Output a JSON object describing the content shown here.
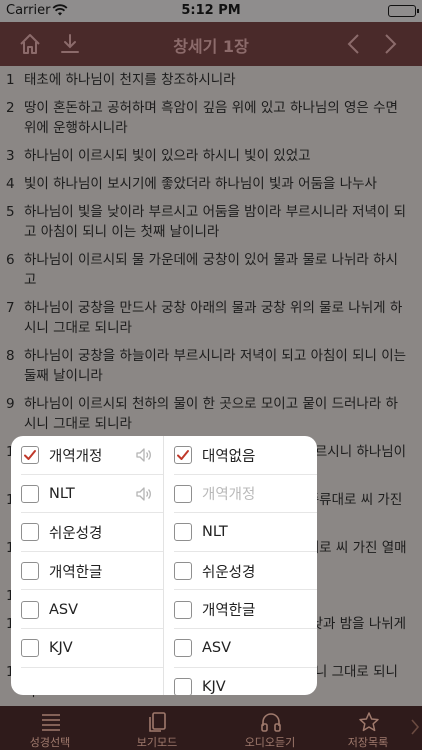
{
  "status_bar": {
    "carrier": "Carrier",
    "time": "5:12 PM"
  },
  "nav": {
    "title": "창세기 1장",
    "icons": [
      "home-icon",
      "download-icon",
      "chevron-left-icon",
      "chevron-right-icon"
    ]
  },
  "verses": [
    {
      "num": "1",
      "text": "태초에 하나님이 천지를 창조하시니라"
    },
    {
      "num": "2",
      "text": "땅이 혼돈하고 공허하며 흑암이 깊음 위에 있고 하나님의 영은 수면 위에 운행하시니라"
    },
    {
      "num": "3",
      "text": "하나님이 이르시되 빛이 있으라 하시니 빛이 있었고"
    },
    {
      "num": "4",
      "text": "빛이 하나님이 보시기에 좋았더라 하나님이 빛과 어둠을 나누사"
    },
    {
      "num": "5",
      "text": "하나님이 빛을 낮이라 부르시고 어둠을 밤이라 부르시니라 저녁이 되고 아침이 되니 이는 첫째 날이니라"
    },
    {
      "num": "6",
      "text": "하나님이 이르시되 물 가운데에 궁창이 있어 물과 물로 나뉘라 하시고"
    },
    {
      "num": "7",
      "text": "하나님이 궁창을 만드사 궁창 아래의 물과 궁창 위의 물로 나뉘게 하시니 그대로 되니라"
    },
    {
      "num": "8",
      "text": "하나님이 궁창을 하늘이라 부르시니라 저녁이 되고 아침이 되니 이는 둘째 날이니라"
    },
    {
      "num": "9",
      "text": "하나님이 이르시되 천하의 물이 한 곳으로 모이고 뭍이 드러나라 하시니 그대로 되니라"
    },
    {
      "num": "10",
      "text": "하나님이 뭍을 땅이라 부르시고 모인 물을 바다라 부르시니 하나님이 보시기에 좋았더라"
    },
    {
      "num": "11",
      "text": "하나님이 이르시되 땅은 풀과 씨 맺는 채소와 각기 종류대로 씨 가진 열매 맺는 나무를 내라 하시니 그대로 되어"
    },
    {
      "num": "12",
      "text": "땅이 풀과 각기 종류대로 씨 맺는 채소와 각기 종류대로 씨 가진 열매 맺는 나무를 내니 하나님이 보시기에 좋았더라"
    },
    {
      "num": "13",
      "text": "저녁이 되고 아침이 되니 이는 셋째 날이니라"
    },
    {
      "num": "14",
      "text": "하나님이 이르시되 하늘의 궁창에 광명체들이 있어 낮과 밤을 나뉘게 하고 그것들로 징조와 계절과 날과 해를 이루게 하라"
    },
    {
      "num": "15",
      "text": "또 광명체들이 하늘의 궁창에 있어 땅을 비추라 하시니 그대로 되니라"
    },
    {
      "num": "16",
      "text": "하나님이 두 큰 광명체를 만드사 큰 광명체로 낮을 주관하게 하시고 작은 광명체로 밤을 주관하게 하시며 또 별들을 만드시고"
    },
    {
      "num": "17",
      "text": "하나님이 그것들을 하늘의 궁창에 두어 땅을 비추게 하시며"
    }
  ],
  "popup": {
    "left": [
      {
        "label": "개역개정",
        "checked": true,
        "disabled": false,
        "speaker": true
      },
      {
        "label": "NLT",
        "checked": false,
        "disabled": false,
        "speaker": true
      },
      {
        "label": "쉬운성경",
        "checked": false,
        "disabled": false,
        "speaker": false
      },
      {
        "label": "개역한글",
        "checked": false,
        "disabled": false,
        "speaker": false
      },
      {
        "label": "ASV",
        "checked": false,
        "disabled": false,
        "speaker": false
      },
      {
        "label": "KJV",
        "checked": false,
        "disabled": false,
        "speaker": false
      }
    ],
    "right": [
      {
        "label": "대역없음",
        "checked": true,
        "disabled": false
      },
      {
        "label": "개역개정",
        "checked": false,
        "disabled": true
      },
      {
        "label": "NLT",
        "checked": false,
        "disabled": false
      },
      {
        "label": "쉬운성경",
        "checked": false,
        "disabled": false
      },
      {
        "label": "개역한글",
        "checked": false,
        "disabled": false
      },
      {
        "label": "ASV",
        "checked": false,
        "disabled": false
      },
      {
        "label": "KJV",
        "checked": false,
        "disabled": false
      }
    ]
  },
  "tabs": [
    {
      "label": "성경선택",
      "icon": "list-icon"
    },
    {
      "label": "보기모드",
      "icon": "pages-icon"
    },
    {
      "label": "오디오듣기",
      "icon": "headphones-icon"
    },
    {
      "label": "저장목록",
      "icon": "star-icon"
    }
  ],
  "colors": {
    "nav_bg": "#4a2a2a",
    "tab_bg": "#2f1b1b",
    "check": "#c0392b",
    "tab_fg": "#a07a6d"
  }
}
